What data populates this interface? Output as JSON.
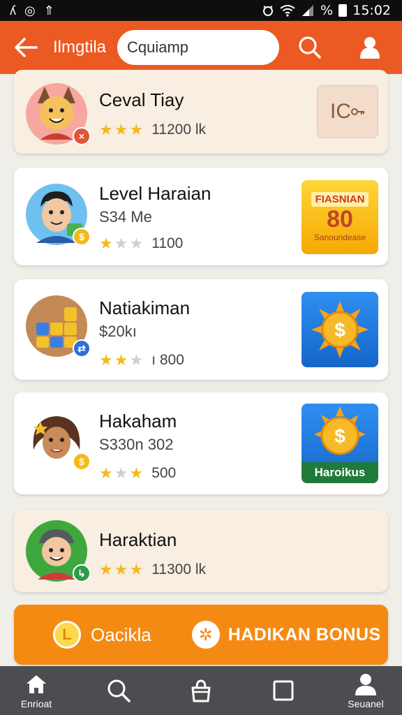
{
  "status_bar": {
    "left_icons": [
      "signal-alt-icon",
      "messenger-icon",
      "upload-icon"
    ],
    "left_glyphs": [
      "ʎ",
      "◎",
      "⇑"
    ],
    "battery_percent": "%",
    "time": "15:02"
  },
  "app_bar": {
    "title": "Ilmgtila",
    "search_value": "Cquiamp",
    "accent_color": "#ec5a23"
  },
  "cards": [
    {
      "name": "Ceval Tiay",
      "subtitle": "",
      "stars_filled": 3,
      "stars_total": 3,
      "rating_text": "11200 lk",
      "thumb_text": "IC",
      "thumb_icon": "key-icon",
      "badge_icon": "close-icon",
      "tinted": true
    },
    {
      "name": "Level Haraian",
      "subtitle": "S34 Me",
      "stars_filled": 1,
      "stars_total": 3,
      "rating_text": "1100",
      "thumb_banner": "FIASNIAN",
      "thumb_number": "80",
      "thumb_caption": "Sanoundease",
      "badge_icon": "coin-icon",
      "tinted": false
    },
    {
      "name": "Natiakiman",
      "subtitle": "$20kı",
      "stars_filled": 2,
      "stars_total": 3,
      "rating_text": "ı 800",
      "thumb_symbol": "$",
      "badge_icon": "swap-icon",
      "tinted": false
    },
    {
      "name": "Hakaham",
      "subtitle": "S330n 302",
      "stars_filled": 2,
      "stars_total": 3,
      "rating_text": "500",
      "thumb_symbol": "$",
      "thumb_caption": "Haroikus",
      "badge_icon": "coin-icon",
      "tinted": false
    },
    {
      "name": "Haraktian",
      "subtitle": "",
      "stars_filled": 3,
      "stars_total": 3,
      "rating_text": "11300 lk",
      "badge_icon": "arrow-icon",
      "tinted": true
    }
  ],
  "bonus_bar": {
    "left_label": "Oacikla",
    "right_label": "HADIKAN BONUS",
    "color": "#f58a13"
  },
  "bottom_nav": [
    {
      "icon": "home-icon",
      "label": "Enrioat"
    },
    {
      "icon": "search-icon",
      "label": ""
    },
    {
      "icon": "bag-icon",
      "label": ""
    },
    {
      "icon": "square-icon",
      "label": ""
    },
    {
      "icon": "user-icon",
      "label": "Seuanel"
    }
  ]
}
